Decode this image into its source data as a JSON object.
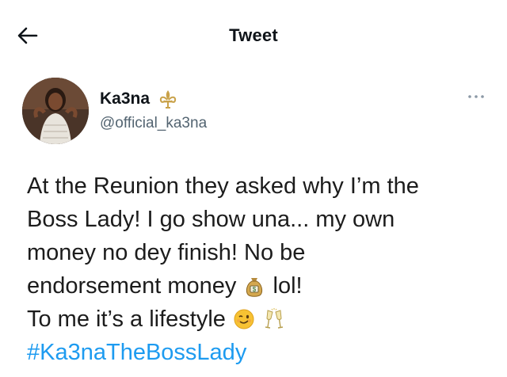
{
  "header": {
    "title": "Tweet",
    "back_icon": "arrow-left-icon"
  },
  "author": {
    "display_name": "Ka3na",
    "handle": "@official_ka3na",
    "badge_icon": "fleur-de-lis-icon",
    "more_icon": "more-dots-icon"
  },
  "tweet": {
    "line1": "At the Reunion they asked why I’m the",
    "line2": "Boss Lady! I go show una... my own",
    "line3": "money no dey finish! No be",
    "line4_before": "endorsement money",
    "line4_emoji": "money-bag-icon",
    "line4_after": " lol!",
    "line5_before": "To me it’s a lifestyle",
    "line5_emoji1": "winking-face-icon",
    "line5_emoji2": "clinking-glasses-icon",
    "hashtag": "#Ka3naTheBossLady"
  },
  "colors": {
    "text": "#0f1419",
    "secondary": "#536471",
    "link": "#1d9bf0",
    "badge": "#c9a24a"
  }
}
